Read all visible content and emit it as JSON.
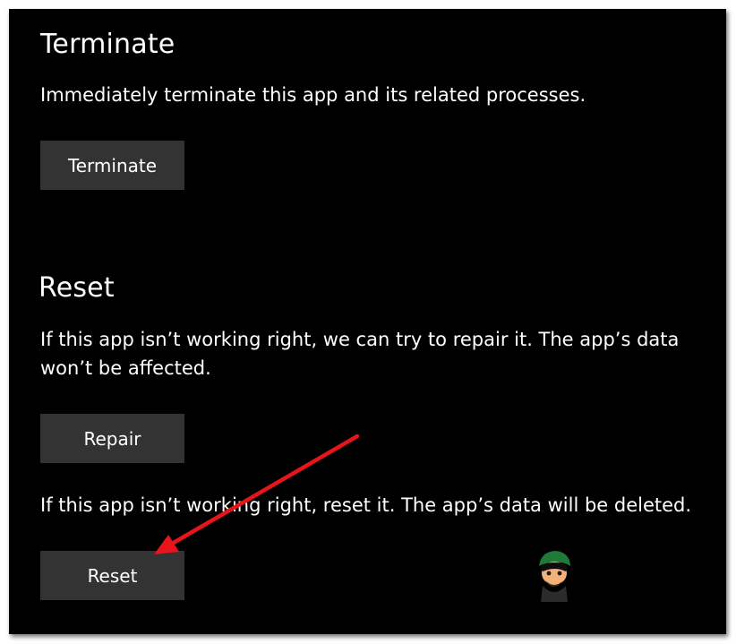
{
  "terminate": {
    "heading": "Terminate",
    "description": "Immediately terminate this app and its related processes.",
    "button_label": "Terminate"
  },
  "reset_section": {
    "heading": "Reset",
    "repair_description": "If this app isn’t working right, we can try to repair it. The app’s data won’t be affected.",
    "repair_button_label": "Repair",
    "reset_description": "If this app isn’t working right, reset it. The app’s data will be deleted.",
    "reset_button_label": "Reset"
  },
  "annotation": {
    "arrow_color": "#e8141c",
    "points_to": "reset-button"
  },
  "colors": {
    "background": "#000000",
    "button": "#333333",
    "text": "#ffffff"
  }
}
